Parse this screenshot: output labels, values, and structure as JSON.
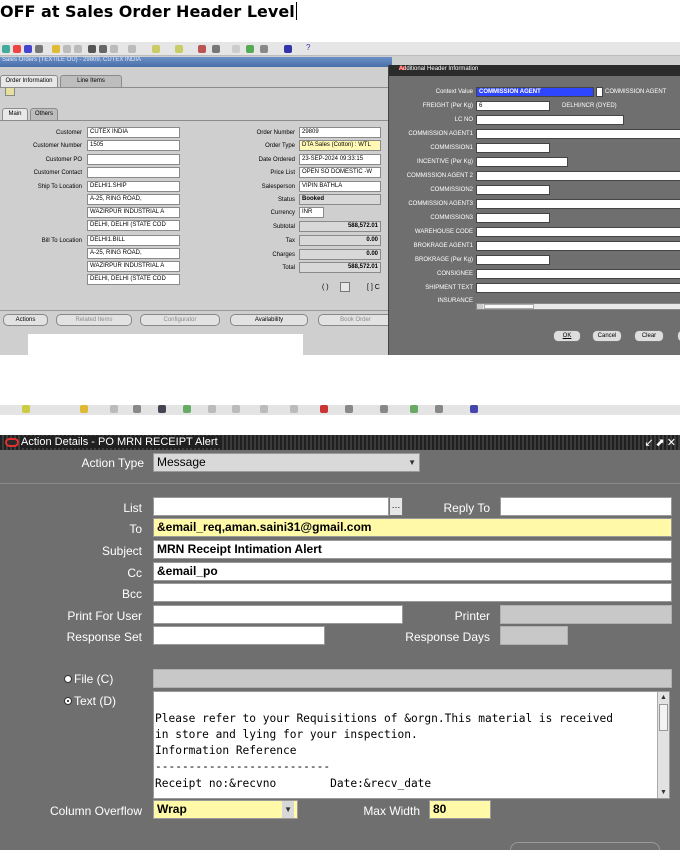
{
  "heading": "OFF at Sales Order Header Level",
  "sales_order": {
    "window_title": "Sales Orders (TEXTILE OU) - 29809, CUTEX INDIA",
    "tabs": [
      "Order Information",
      "Line Items"
    ],
    "subtabs": [
      "Main",
      "Others"
    ],
    "left_fields": [
      {
        "label": "Customer",
        "value": "CUTEX INDIA"
      },
      {
        "label": "Customer Number",
        "value": "1505"
      },
      {
        "label": "Customer PO",
        "value": ""
      },
      {
        "label": "Customer Contact",
        "value": ""
      },
      {
        "label": "Ship To Location",
        "value": "DELHI1.SHIP"
      }
    ],
    "ship_to_lines": [
      "A-25, RING ROAD,",
      "WAZIRPUR INDUSTRIAL A",
      "DELHI, DELHI (STATE COD"
    ],
    "bill_to_label": "Bill To Location",
    "bill_to_lines": [
      "DELHI1.BILL",
      "A-25, RING ROAD,",
      "WAZIRPUR INDUSTRIAL A",
      "DELHI, DELHI (STATE COD"
    ],
    "right_fields": [
      {
        "label": "Order Number",
        "value": "29809"
      },
      {
        "label": "Order Type",
        "value": "DTA Sales (Cotton) : WTL"
      },
      {
        "label": "Date Ordered",
        "value": "23-SEP-2024 09:33:15"
      },
      {
        "label": "Price List",
        "value": "OPEN SO DOMESTIC -W"
      },
      {
        "label": "Salesperson",
        "value": "VIPIN BATHLA"
      },
      {
        "label": "Status",
        "value": "Booked"
      },
      {
        "label": "Currency",
        "value": "INR"
      },
      {
        "label": "Subtotal",
        "value": "588,572.01"
      },
      {
        "label": "Tax",
        "value": "0.00"
      },
      {
        "label": "Charges",
        "value": "0.00"
      },
      {
        "label": "Total",
        "value": "588,572.01"
      }
    ],
    "buttons": [
      "Actions",
      "Related Items",
      "Configurator",
      "Availability",
      "Book Order"
    ]
  },
  "additional_header": {
    "title": "Additional Header Information",
    "context_label": "Context Value",
    "context_value": "COMMISSION AGENT",
    "context_desc": "COMMISSION AGENT",
    "freight_value": "6",
    "freight_desc": "DELHI/NCR (DYED)",
    "labels": [
      "FREIGHT (Per Kg)",
      "LC NO",
      "COMMISSION AGENT1",
      "COMMISSION1",
      "INCENTIVE (Per Kg)",
      "COMMISSION AGENT 2",
      "COMMISSION2",
      "COMMISSION AGENT3",
      "COMMISSION3",
      "WAREHOUSE CODE",
      "BROKRAGE AGENT1",
      "BROKRAGE (Per Kg)",
      "CONSIGNEE",
      "SHIPMENT TEXT",
      "INSURANCE"
    ],
    "buttons": [
      "OK",
      "Cancel",
      "Clear"
    ]
  },
  "action_details": {
    "title": "Action Details - PO MRN RECEIPT Alert",
    "action_type_label": "Action Type",
    "action_type_value": "Message",
    "list_label": "List",
    "list_value": "",
    "reply_to_label": "Reply To",
    "to_label": "To",
    "to_value": "&email_req,aman.saini31@gmail.com",
    "subject_label": "Subject",
    "subject_value": "MRN Receipt Intimation Alert",
    "cc_label": "Cc",
    "cc_value": "&email_po",
    "bcc_label": "Bcc",
    "print_label": "Print For User",
    "printer_label": "Printer",
    "response_set_label": "Response Set",
    "response_days_label": "Response Days",
    "file_label": "File (C)",
    "text_label": "Text (D)",
    "text_lines": [
      "Please refer to your Requisitions of &orgn.This material is received",
      "in store and lying for your inspection.",
      "Information Reference",
      "--------------------------",
      "Receipt no:&recvno        Date:&recv_date"
    ],
    "column_overflow_label": "Column Overflow",
    "column_overflow_value": "Wrap",
    "max_width_label": "Max Width",
    "max_width_value": "80"
  }
}
